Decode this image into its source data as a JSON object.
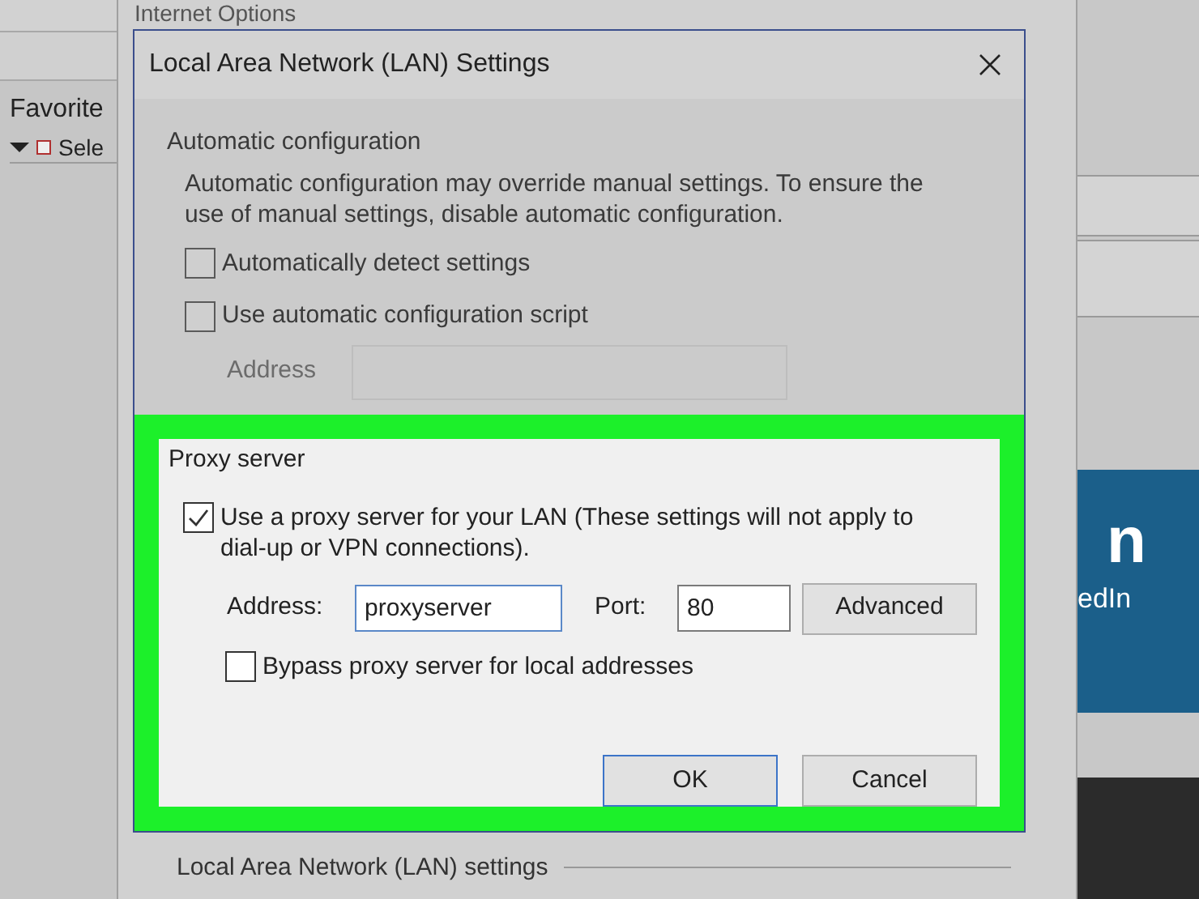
{
  "background_window": {
    "menu_item": "Favorite",
    "toolbar_item": "Sele"
  },
  "internet_options": {
    "title": "Internet Options",
    "section_label": "Local Area Network (LAN) settings"
  },
  "page_banner": {
    "text_1": "n",
    "text_2": "edIn"
  },
  "dialog": {
    "title": "Local Area Network (LAN) Settings",
    "automatic": {
      "heading": "Automatic configuration",
      "description": "Automatic configuration may override manual settings.  To ensure the use of manual settings, disable automatic configuration.",
      "disabled": true,
      "options": [
        {
          "label": "Automatically detect settings",
          "checked": false
        },
        {
          "label": "Use automatic configuration script",
          "checked": false
        }
      ],
      "address_label": "Address"
    },
    "proxy": {
      "heading": "Proxy server",
      "highlighted": true,
      "use_proxy": {
        "label": "Use a proxy server for your LAN (These settings will not apply to dial-up or VPN connections).",
        "checked": true
      },
      "address_label": "Address:",
      "address_value": "proxyserver",
      "port_label": "Port:",
      "port_value": "80",
      "advanced_button": "Advanced",
      "bypass": {
        "label": "Bypass proxy server for local addresses",
        "checked": false
      }
    },
    "buttons": [
      {
        "label": "OK",
        "selected": true
      },
      {
        "label": "Cancel",
        "selected": false
      }
    ]
  }
}
